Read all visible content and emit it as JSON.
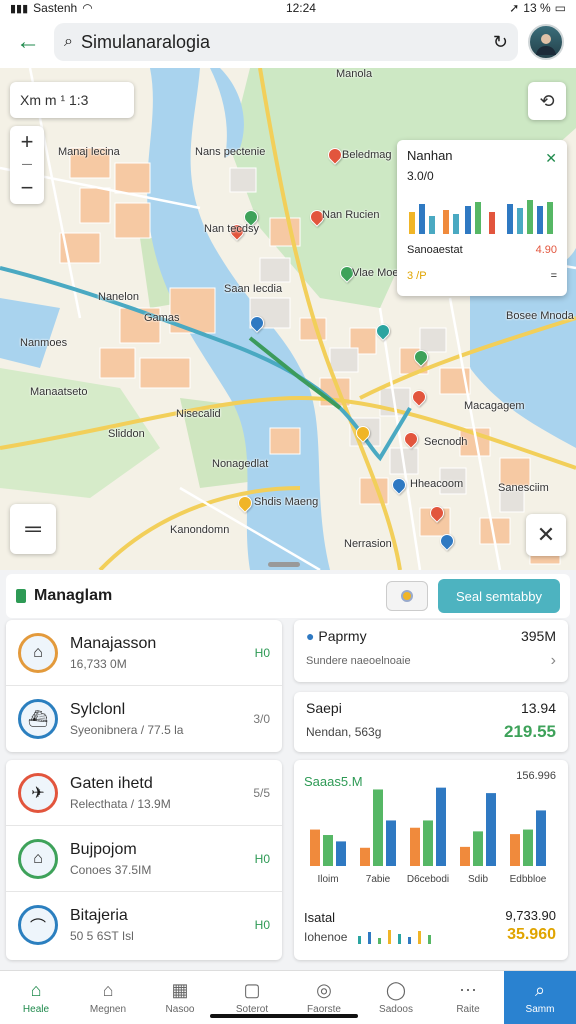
{
  "status": {
    "carrier": "Sastenh",
    "time": "12:24",
    "battery": "13 %"
  },
  "search": {
    "value": "Simulanaralogia"
  },
  "map": {
    "scale_text": "Xm  m  ¹ 1:3",
    "labels": [
      "Manaj lecina",
      "Nans pectenie",
      "Beledmag",
      "Nan tecdsy",
      "Nan Rucien",
      "Vlae Moe",
      "Manola",
      "Saan Iecdia",
      "Gamas",
      "Nanelon",
      "Nanmoes",
      "Manaatseto",
      "Sliddon",
      "Nisecalid",
      "Nonagedlat",
      "Macagagem",
      "Secnodh",
      "Hheacoom",
      "Kanondomn",
      "Shdis Maeng",
      "Nerrasion",
      "Sanesciim",
      "Bosee Mnoda"
    ],
    "info_card": {
      "title": "Nanhan",
      "value": "3.0/0",
      "row1_label": "Sanoaestat",
      "row1_value": "4.90",
      "row2_label": "3 /P",
      "row2_value": "="
    }
  },
  "panel": {
    "title": "Managlam",
    "action_label": "Seal semtabby",
    "list1": [
      {
        "title": "Manajasson",
        "subtitle": "16,733 0M",
        "meta": "H0"
      },
      {
        "title": "Sylclonl",
        "subtitle": "Syeonibnera / 77.5 la",
        "meta": "3/0"
      }
    ],
    "list2": [
      {
        "title": "Gaten ihetd",
        "subtitle": "Relecthata / 13.9M",
        "meta": "5/5"
      },
      {
        "title": "Bujpojom",
        "subtitle": "Conoes 37.5IM",
        "meta": "H0"
      },
      {
        "title": "Bitajeria",
        "subtitle": "50 5 6ST Isl",
        "meta": "H0"
      }
    ],
    "stat1": {
      "title": "Paprmy",
      "value": "395M",
      "subtitle": "Sundere naeoelnoaie"
    },
    "stat2": {
      "title": "Saepi",
      "value": "13.94",
      "subtitle": "Nendan, 563g",
      "highlight": "219.55"
    },
    "chart_card": {
      "title": "Saaas5.M",
      "top_value": "156.996",
      "footer_label": "Isatal",
      "footer_value": "9,733.90",
      "footer_sub": "Iohenoe",
      "footer_highlight": "35.960"
    }
  },
  "chart_data": {
    "type": "bar",
    "title": "Saaas5.M",
    "categories": [
      "Iloim",
      "7abie",
      "D6cebodi",
      "Sdib",
      "Edbbloe"
    ],
    "series": [
      {
        "name": "orange",
        "values": [
          4.0,
          2.0,
          4.2,
          2.1,
          3.5
        ],
        "color": "#f08a3c"
      },
      {
        "name": "green",
        "values": [
          3.4,
          8.4,
          5.0,
          3.8,
          4.0
        ],
        "color": "#56b765"
      },
      {
        "name": "blue",
        "values": [
          2.7,
          5.0,
          8.6,
          8.0,
          6.1
        ],
        "color": "#2f79c2"
      }
    ]
  },
  "nav": [
    {
      "label": "Heale",
      "icon": "⌂"
    },
    {
      "label": "Megnen",
      "icon": "⌂"
    },
    {
      "label": "Nasoo",
      "icon": "▦"
    },
    {
      "label": "Soterot",
      "icon": "▢"
    },
    {
      "label": "Faorste",
      "icon": "◎"
    },
    {
      "label": "Sadoos",
      "icon": "◯"
    },
    {
      "label": "Raite",
      "icon": "⋯"
    },
    {
      "label": "Samm",
      "icon": "⌕"
    }
  ]
}
